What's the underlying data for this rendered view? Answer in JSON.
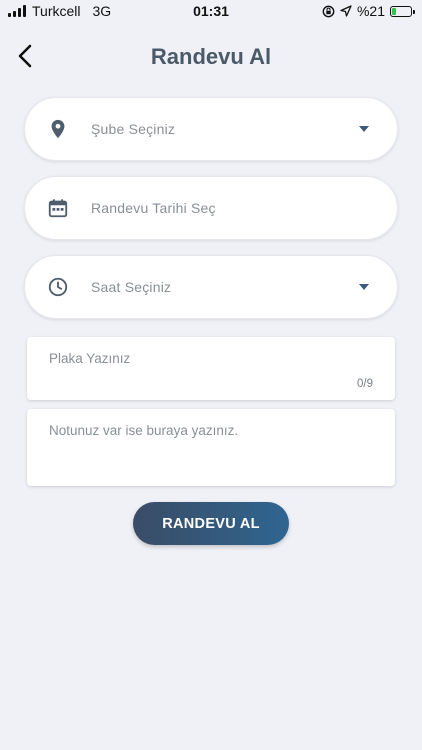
{
  "status_bar": {
    "carrier": "Turkcell",
    "network": "3G",
    "time": "01:31",
    "battery_percent": "%21",
    "battery_level": 0.21,
    "icons": [
      "signal-icon",
      "orientation-lock-icon",
      "location-arrow-icon",
      "battery-icon"
    ]
  },
  "header": {
    "title": "Randevu Al",
    "back_icon": "chevron-left-icon"
  },
  "form": {
    "branch": {
      "placeholder": "Şube Seçiniz",
      "icon": "location-pin-icon",
      "dropdown": "caret-down-icon"
    },
    "date": {
      "placeholder": "Randevu Tarihi Seç",
      "icon": "calendar-icon"
    },
    "time": {
      "placeholder": "Saat Seçiniz",
      "icon": "clock-icon",
      "dropdown": "caret-down-icon"
    },
    "plate": {
      "placeholder": "Plaka Yazınız",
      "counter": "0/9"
    },
    "note": {
      "placeholder": "Notunuz var ise buraya yazınız."
    },
    "submit_label": "RANDEVU AL"
  },
  "colors": {
    "background": "#f0f1f6",
    "title": "#4a5a68",
    "icon": "#4e5e6c",
    "caret": "#3d5a80",
    "button_gradient_start": "#3a4c66",
    "button_gradient_end": "#2f6590",
    "battery": "#36c24a"
  }
}
